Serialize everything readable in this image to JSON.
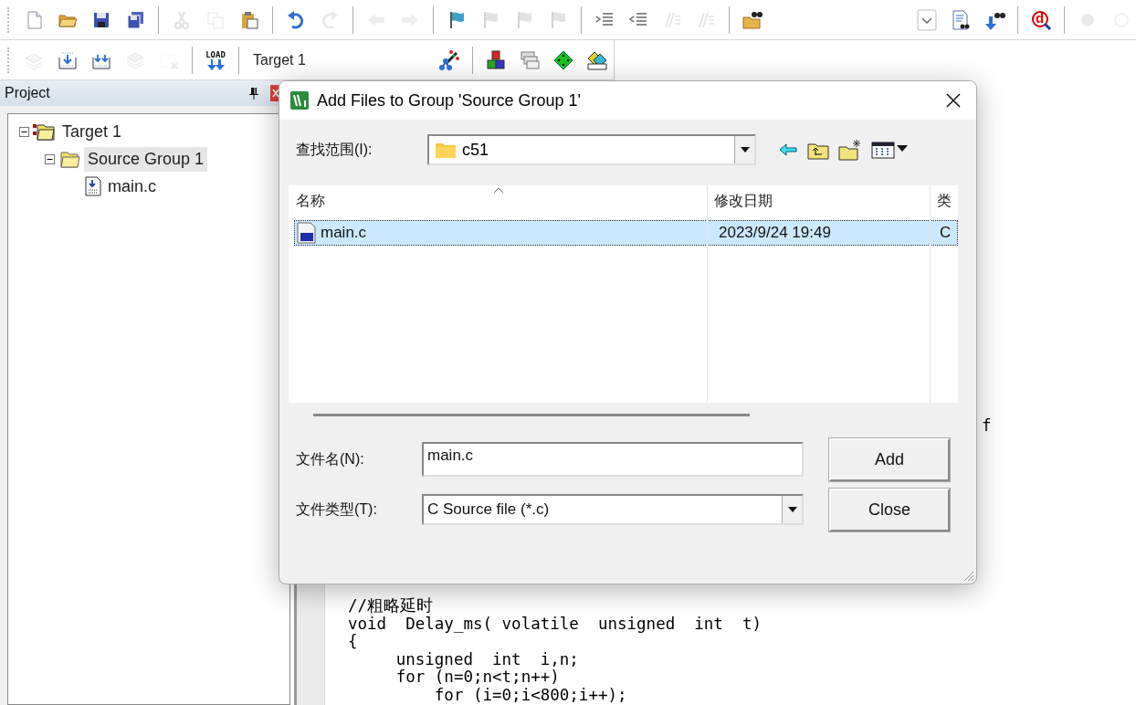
{
  "toolbar_rows": [
    {
      "items": [
        {
          "kind": "new-file",
          "disabled": false
        },
        {
          "kind": "open",
          "disabled": false
        },
        {
          "kind": "save",
          "disabled": false
        },
        {
          "kind": "save-all",
          "disabled": false
        },
        {
          "kind": "separator"
        },
        {
          "kind": "cut",
          "disabled": true
        },
        {
          "kind": "copy",
          "disabled": true
        },
        {
          "kind": "paste",
          "disabled": false
        },
        {
          "kind": "separator"
        },
        {
          "kind": "undo",
          "disabled": false
        },
        {
          "kind": "redo",
          "disabled": true
        },
        {
          "kind": "separator"
        },
        {
          "kind": "back",
          "disabled": true
        },
        {
          "kind": "forward",
          "disabled": true
        },
        {
          "kind": "separator"
        },
        {
          "kind": "bookmark",
          "disabled": false
        },
        {
          "kind": "bookmark",
          "disabled": true
        },
        {
          "kind": "bookmark",
          "disabled": true
        },
        {
          "kind": "bookmark",
          "disabled": true
        },
        {
          "kind": "separator"
        },
        {
          "kind": "indent",
          "disabled": false
        },
        {
          "kind": "unindent",
          "disabled": false
        },
        {
          "kind": "comment",
          "disabled": true
        },
        {
          "kind": "comment",
          "disabled": true
        },
        {
          "kind": "separator"
        },
        {
          "kind": "find-in-files",
          "disabled": false
        },
        {
          "kind": "spacer"
        },
        {
          "kind": "dropdown",
          "disabled": false
        },
        {
          "kind": "find",
          "disabled": false
        },
        {
          "kind": "incremental-find",
          "disabled": false
        },
        {
          "kind": "separator"
        },
        {
          "kind": "debug",
          "disabled": false,
          "label": "d"
        },
        {
          "kind": "separator"
        },
        {
          "kind": "breakpoint",
          "disabled": true
        },
        {
          "kind": "breakpoint-empty",
          "disabled": true
        }
      ]
    },
    {
      "items": [
        {
          "kind": "translate",
          "disabled": true
        },
        {
          "kind": "build",
          "disabled": false
        },
        {
          "kind": "rebuild",
          "disabled": false
        },
        {
          "kind": "batch",
          "disabled": true
        },
        {
          "kind": "stop",
          "disabled": true
        },
        {
          "kind": "separator"
        },
        {
          "kind": "load",
          "disabled": false,
          "label": "LOAD"
        },
        {
          "kind": "separator"
        },
        {
          "kind": "combo",
          "value": "Target 1"
        },
        {
          "kind": "wand",
          "disabled": false
        },
        {
          "kind": "separator"
        },
        {
          "kind": "components",
          "disabled": false
        },
        {
          "kind": "windows",
          "disabled": false
        },
        {
          "kind": "diamond",
          "disabled": false
        },
        {
          "kind": "packs",
          "disabled": false
        }
      ]
    }
  ],
  "project": {
    "title": "Project",
    "tree": [
      {
        "kind": "target",
        "label": "Target 1",
        "expanded": true,
        "selected": false,
        "children": [
          {
            "kind": "group",
            "label": "Source Group 1",
            "expanded": true,
            "selected": true,
            "children": [
              {
                "kind": "file",
                "label": "main.c",
                "selected": false
              }
            ]
          }
        ]
      }
    ]
  },
  "editor": {
    "visible_fragment": "f",
    "lines": [
      "//粗略延时",
      "void  Delay_ms( volatile  unsigned  int  t)",
      "{",
      "     unsigned  int  i,n;",
      "     for (n=0;n<t;n++)",
      "         for (i=0;i<800;i++);"
    ]
  },
  "dialog": {
    "title": "Add Files to Group 'Source Group 1'",
    "look_in": {
      "label": "查找范围(I):",
      "value": "c51"
    },
    "columns": [
      "名称",
      "修改日期",
      "类"
    ],
    "files": [
      {
        "cells": [
          "main.c",
          "2023/9/24 19:49",
          "C"
        ],
        "selected": true
      }
    ],
    "file_name": {
      "label": "文件名(N):",
      "value": "main.c"
    },
    "file_type": {
      "label": "文件类型(T):",
      "value": "C Source file (*.c)"
    },
    "buttons": [
      "Add",
      "Close"
    ]
  }
}
